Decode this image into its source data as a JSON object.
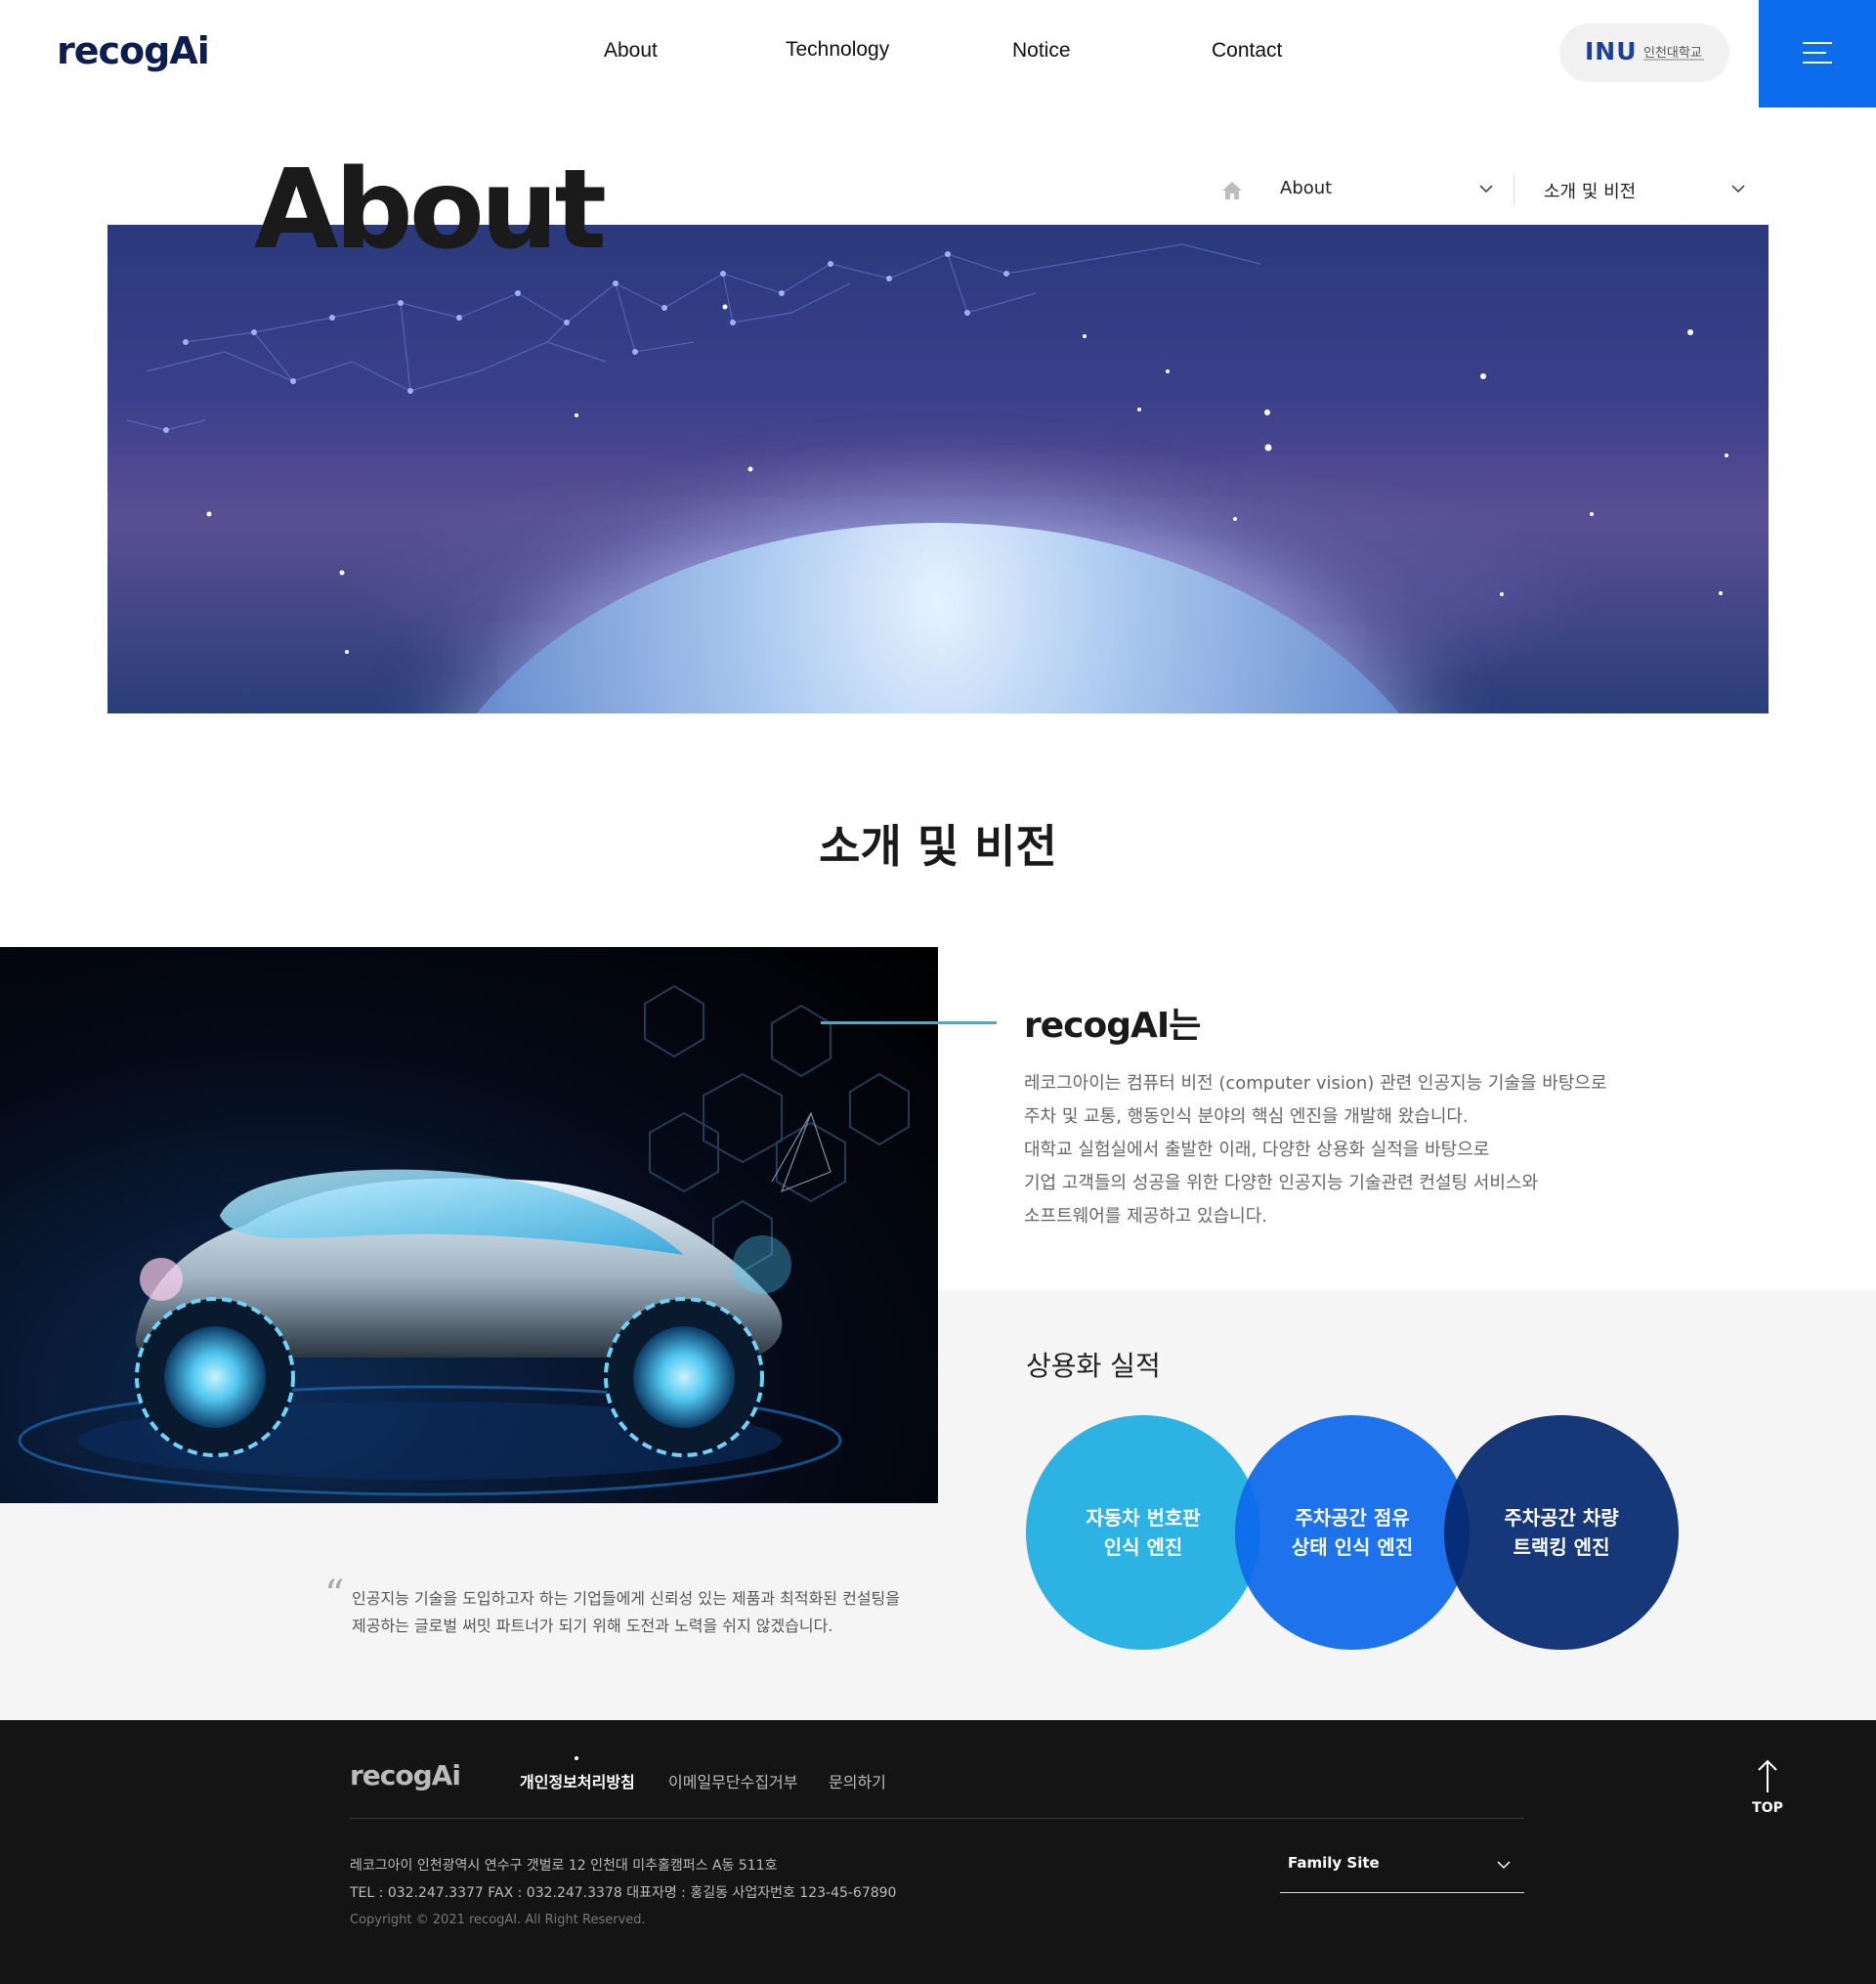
{
  "header": {
    "logo": "recogAi",
    "nav": [
      "About",
      "Technology",
      "Notice",
      "Contact"
    ],
    "partner_badge": {
      "mark": "INU",
      "label": "인천대학교"
    }
  },
  "breadcrumb": {
    "level1": "About",
    "level2": "소개 및 비전"
  },
  "hero": {
    "title": "About"
  },
  "section": {
    "title": "소개 및 비전"
  },
  "intro": {
    "heading": "recogAI는",
    "body": [
      "레코그아이는 컴퓨터 비전 (computer vision) 관련 인공지능 기술을 바탕으로",
      "주차 및 교통, 행동인식 분야의 핵심 엔진을 개발해 왔습니다.",
      "대학교 실험실에서 출발한 이래, 다양한 상용화 실적을 바탕으로",
      "기업 고객들의 성공을 위한 다양한 인공지능 기술관련 컨설팅 서비스와",
      "소프트웨어를 제공하고 있습니다."
    ]
  },
  "achievements": {
    "heading": "상용화 실적",
    "items": [
      "자동차 번호판\n인식 엔진",
      "주차공간 점유\n상태 인식 엔진",
      "주차공간 차량\n트랙킹 엔진"
    ]
  },
  "quote": {
    "mark": "“",
    "lines": [
      "인공지능 기술을 도입하고자 하는 기업들에게 신뢰성 있는 제품과 최적화된 컨설팅을",
      "제공하는 글로벌 써밋 파트너가 되기 위해 도전과 노력을 쉬지 않겠습니다."
    ]
  },
  "footer": {
    "logo": "recogAi",
    "links": [
      "개인정보처리방침",
      "이메일무단수집거부",
      "문의하기"
    ],
    "info_line1": "레코그아이     인천광역시 연수구 갯벌로 12 인천대 미추홀캠퍼스 A동 511호",
    "info_line2": "TEL : 032.247.3377     FAX : 032.247.3378     대표자명 : 홍길동     사업자번호 123-45-67890",
    "copyright": "Copyright © 2021 recogAI. All Right Reserved.",
    "family_site": "Family Site",
    "top_label": "TOP"
  },
  "colors": {
    "brand_blue": "#0b6cec",
    "accent_cyan": "#2db2e4",
    "navy": "#04286e",
    "footer_bg": "#141414"
  },
  "icons": [
    "home-icon",
    "chevron-down-icon",
    "hamburger-menu-icon",
    "arrow-up-icon",
    "quote-icon"
  ]
}
